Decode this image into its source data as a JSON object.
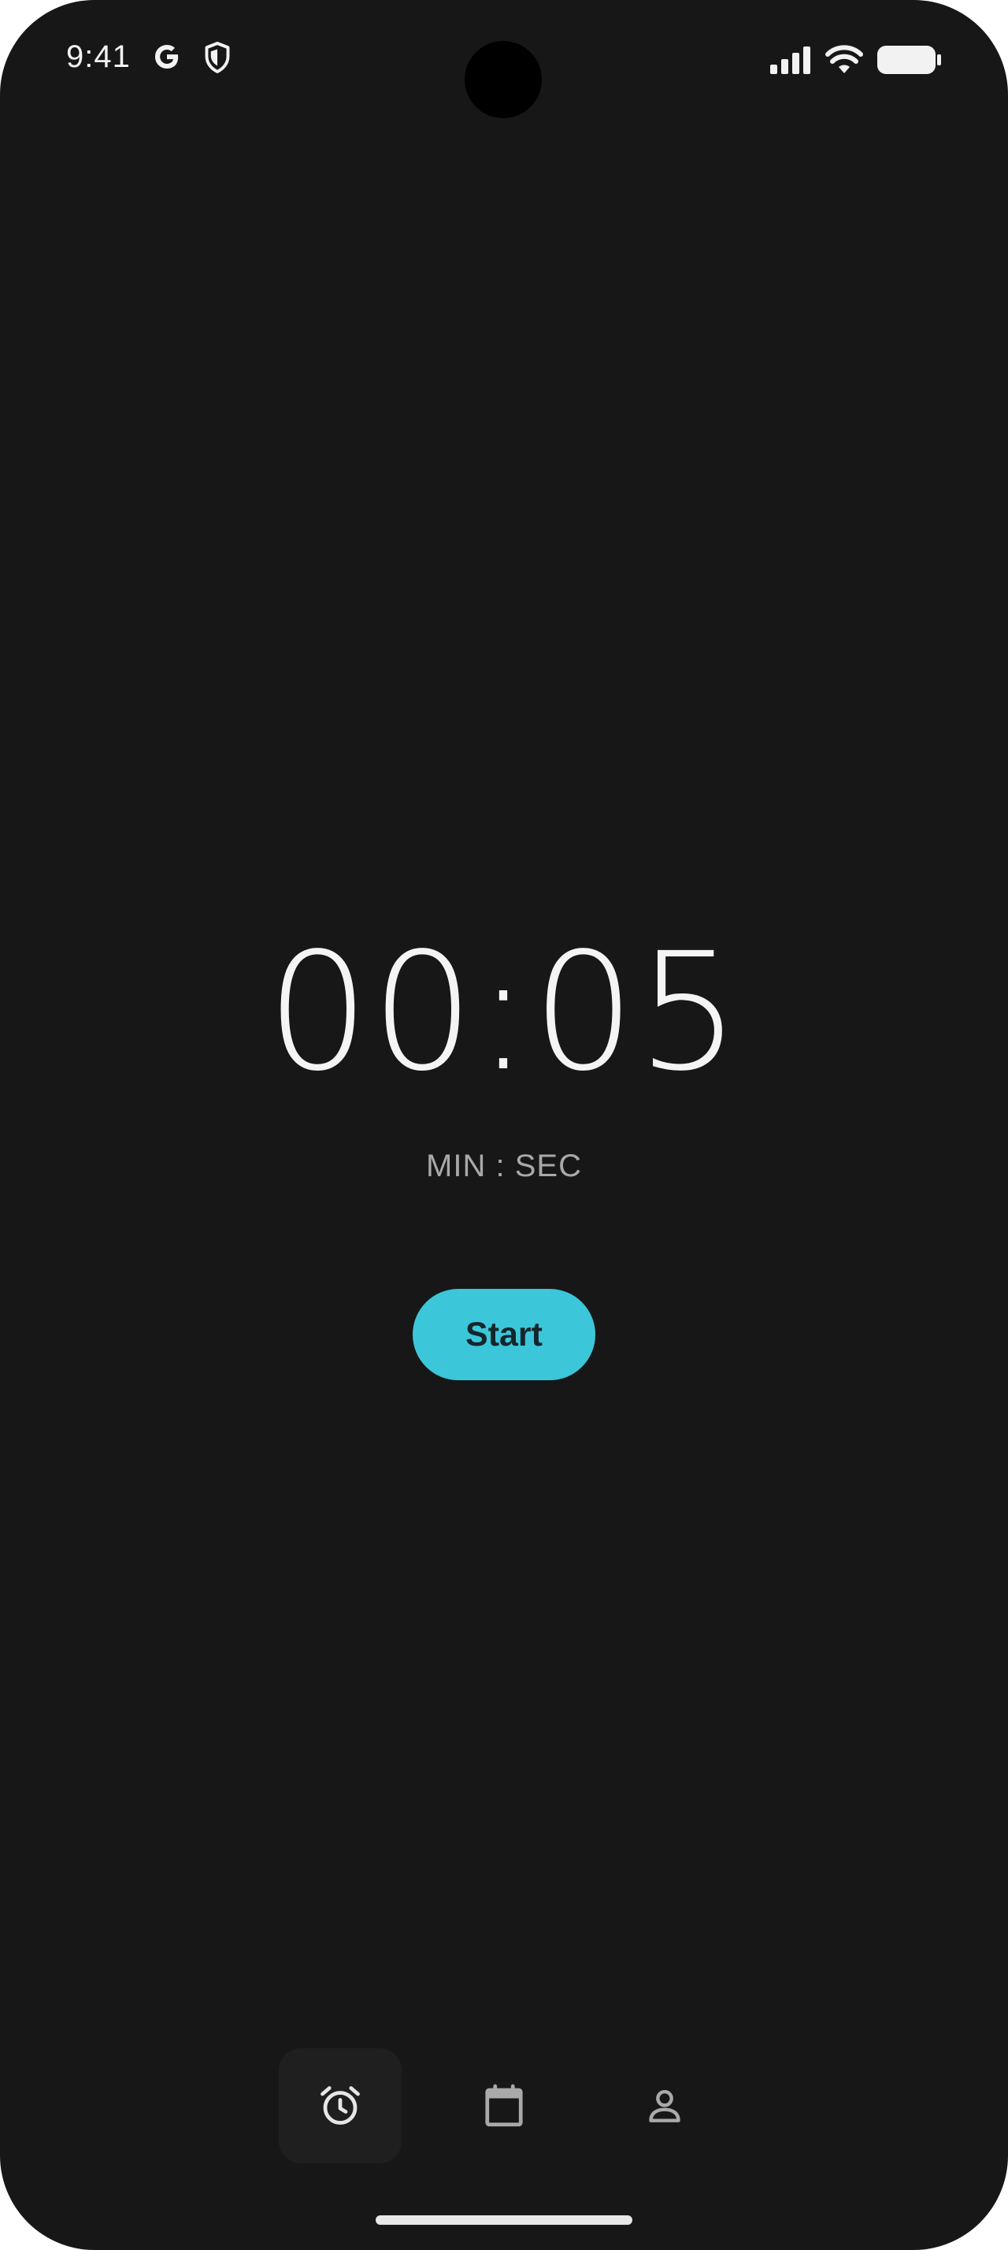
{
  "status_bar": {
    "time": "9:41",
    "google_icon": "google-g-icon",
    "shield_icon": "shield-icon",
    "signal_icon": "cellular-signal-icon",
    "wifi_icon": "wifi-icon",
    "battery_icon": "battery-icon"
  },
  "timer": {
    "display": "00:05",
    "units_label": "MIN : SEC",
    "start_label": "Start"
  },
  "bottom_nav": {
    "items": [
      {
        "icon": "alarm-clock-icon",
        "active": true
      },
      {
        "icon": "calendar-icon",
        "active": false
      },
      {
        "icon": "person-icon",
        "active": false
      }
    ]
  },
  "colors": {
    "background": "#171717",
    "accent": "#3cc6d9",
    "text_primary": "#f4f4f4",
    "text_secondary": "#a9a9a9"
  }
}
